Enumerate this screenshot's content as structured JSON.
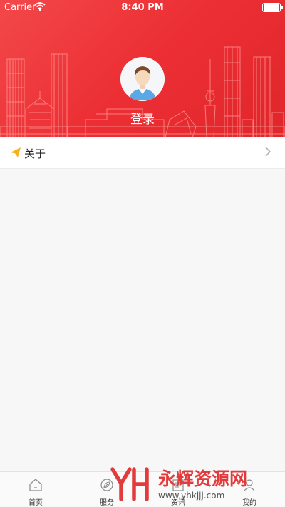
{
  "status_bar": {
    "carrier": "Carrier",
    "time": "8:40 PM"
  },
  "profile": {
    "login_label": "登录"
  },
  "menu": [
    {
      "label": "关于",
      "icon": "paper-plane-icon"
    }
  ],
  "tabs": [
    {
      "label": "首页",
      "icon": "home-icon"
    },
    {
      "label": "服务",
      "icon": "leaf-icon"
    },
    {
      "label": "资讯",
      "icon": "news-icon"
    },
    {
      "label": "我的",
      "icon": "person-icon"
    }
  ],
  "watermark": {
    "title": "永辉资源网",
    "url": "www.yhkjjj.com"
  },
  "colors": {
    "brand_red": "#ec2f34",
    "watermark_red": "#e33b3b"
  }
}
